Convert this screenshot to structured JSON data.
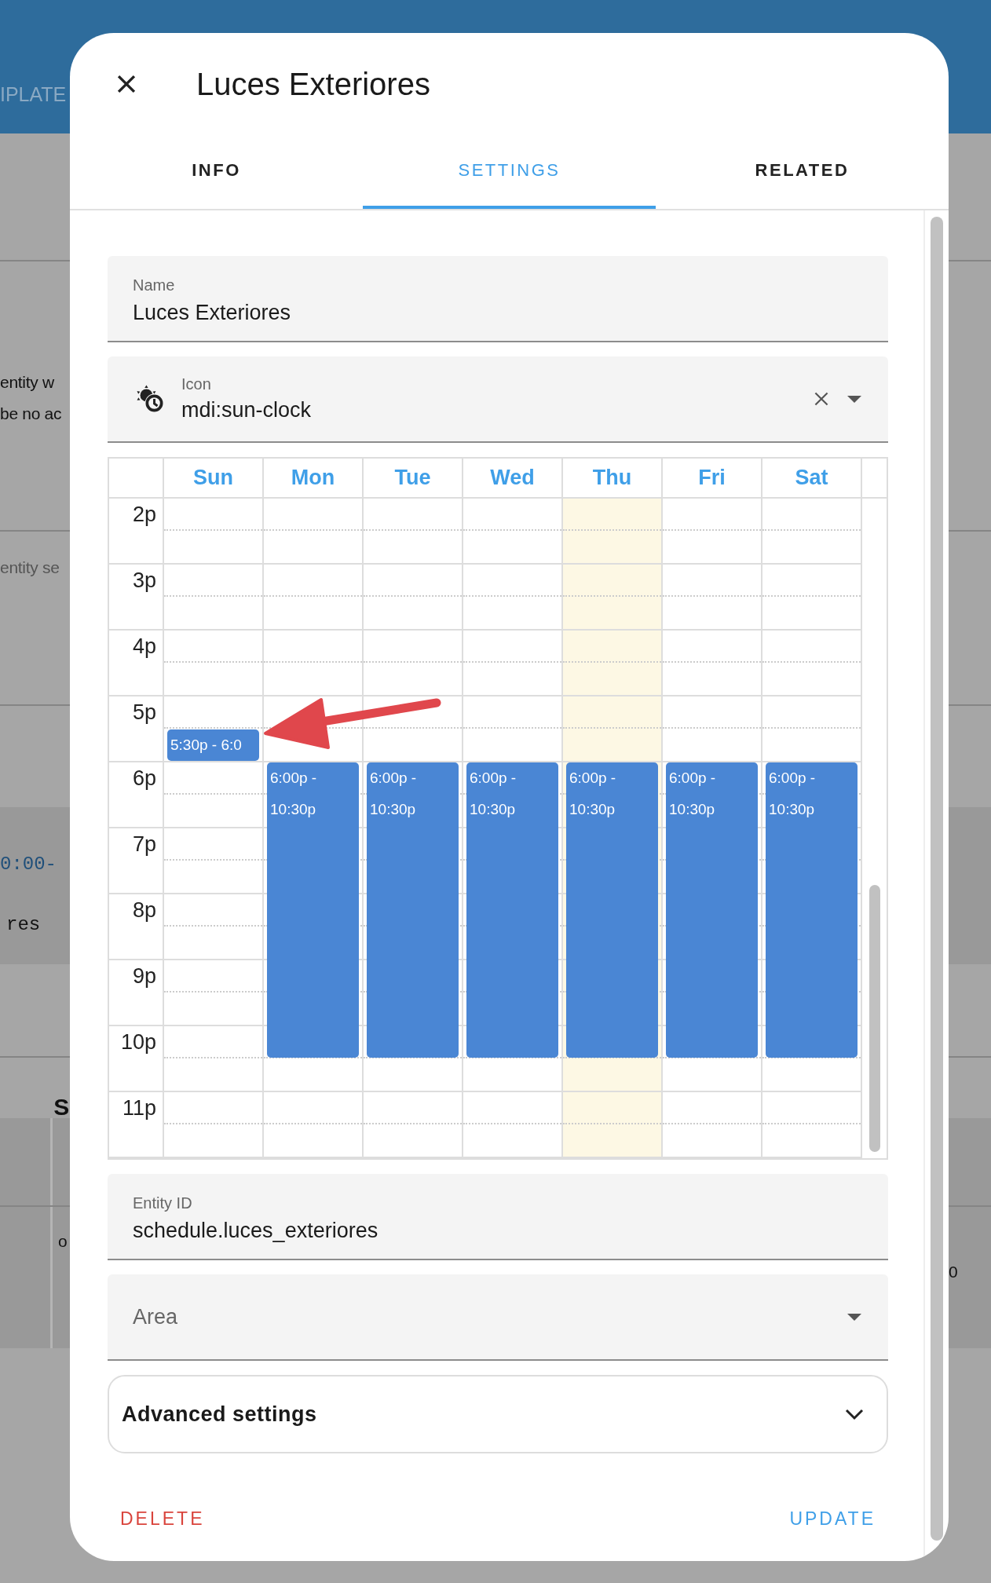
{
  "background_page": {
    "header_text": "IPLATE",
    "fragments": [
      {
        "text": "entity w",
        "kind": "body"
      },
      {
        "text": "be no ac",
        "kind": "body"
      },
      {
        "text": "entity se",
        "kind": "hint"
      },
      {
        "text": "0:00-",
        "kind": "code"
      },
      {
        "text": "res",
        "kind": "mono"
      },
      {
        "text": "S",
        "kind": "heading"
      },
      {
        "text": "o",
        "kind": "body"
      },
      {
        "text": "0",
        "kind": "body"
      }
    ]
  },
  "dialog": {
    "title": "Luces Exteriores",
    "tabs": [
      {
        "label": "INFO",
        "selected": false
      },
      {
        "label": "SETTINGS",
        "selected": true
      },
      {
        "label": "RELATED",
        "selected": false
      }
    ],
    "name_field": {
      "label": "Name",
      "value": "Luces Exteriores"
    },
    "icon_field": {
      "label": "Icon",
      "value": "mdi:sun-clock"
    },
    "schedule": {
      "hours": [
        "2p",
        "3p",
        "4p",
        "5p",
        "6p",
        "7p",
        "8p",
        "9p",
        "10p",
        "11p"
      ],
      "days": [
        {
          "label": "Sun",
          "today": false,
          "events": [
            {
              "text": "5:30p - 6:0"
            }
          ]
        },
        {
          "label": "Mon",
          "today": false,
          "events": [
            {
              "text": "6:00p - 10:30p"
            }
          ]
        },
        {
          "label": "Tue",
          "today": false,
          "events": [
            {
              "text": "6:00p - 10:30p"
            }
          ]
        },
        {
          "label": "Wed",
          "today": false,
          "events": [
            {
              "text": "6:00p - 10:30p"
            }
          ]
        },
        {
          "label": "Thu",
          "today": true,
          "events": [
            {
              "text": "6:00p - 10:30p"
            }
          ]
        },
        {
          "label": "Fri",
          "today": false,
          "events": [
            {
              "text": "6:00p - 10:30p"
            }
          ]
        },
        {
          "label": "Sat",
          "today": false,
          "events": [
            {
              "text": "6:00p - 10:30p"
            }
          ]
        }
      ]
    },
    "entity_id_field": {
      "label": "Entity ID",
      "value": "schedule.luces_exteriores"
    },
    "area_field": {
      "placeholder": "Area"
    },
    "advanced_settings": {
      "label": "Advanced settings",
      "expanded": false
    },
    "buttons": [
      {
        "label": "DELETE",
        "kind": "danger"
      },
      {
        "label": "UPDATE",
        "kind": "primary"
      }
    ]
  }
}
